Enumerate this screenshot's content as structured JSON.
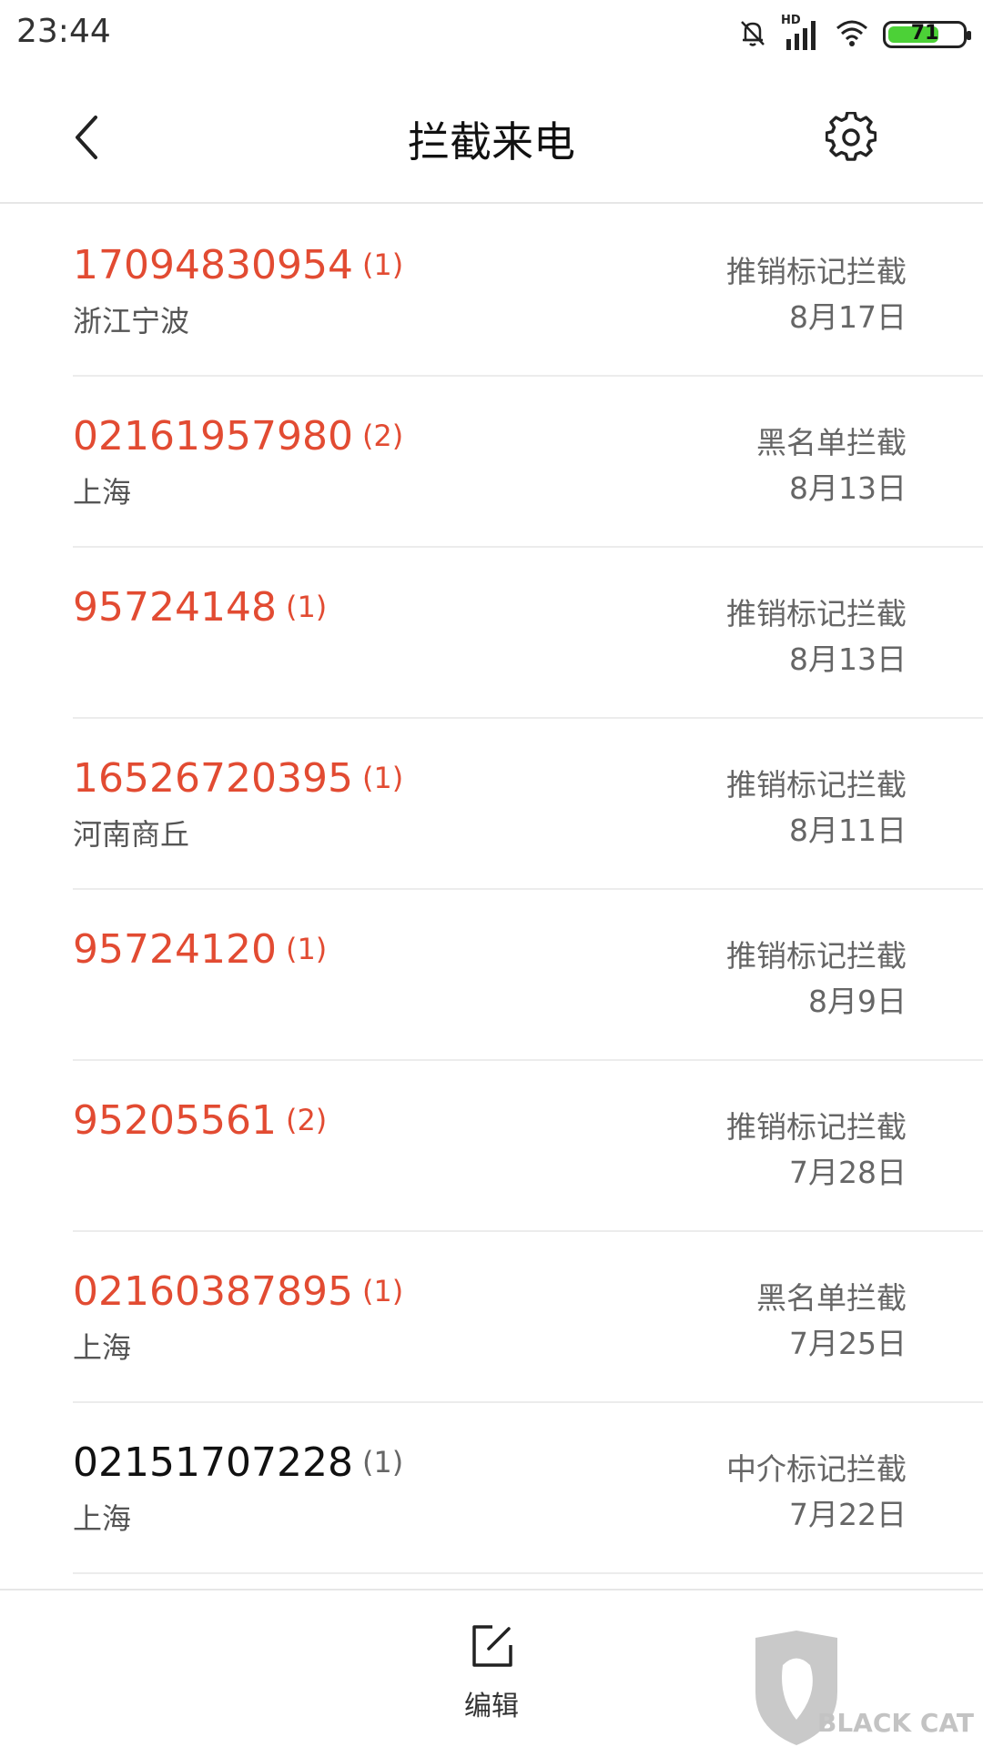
{
  "status_bar": {
    "time": "23:44",
    "hd_label": "HD",
    "battery_level": 71,
    "battery_label": "71",
    "battery_color": "#4cd137"
  },
  "header": {
    "title": "拦截来电",
    "back_icon": "chevron-left-icon",
    "settings_icon": "gear-icon"
  },
  "calls": [
    {
      "number": "17094830954",
      "count": "(1)",
      "location": "浙江宁波",
      "reason": "推销标记拦截",
      "date": "8月17日",
      "highlight": true
    },
    {
      "number": "02161957980",
      "count": "(2)",
      "location": "上海",
      "reason": "黑名单拦截",
      "date": "8月13日",
      "highlight": true
    },
    {
      "number": "95724148",
      "count": "(1)",
      "location": "",
      "reason": "推销标记拦截",
      "date": "8月13日",
      "highlight": true
    },
    {
      "number": "16526720395",
      "count": "(1)",
      "location": "河南商丘",
      "reason": "推销标记拦截",
      "date": "8月11日",
      "highlight": true
    },
    {
      "number": "95724120",
      "count": "(1)",
      "location": "",
      "reason": "推销标记拦截",
      "date": "8月9日",
      "highlight": true
    },
    {
      "number": "95205561",
      "count": "(2)",
      "location": "",
      "reason": "推销标记拦截",
      "date": "7月28日",
      "highlight": true
    },
    {
      "number": "02160387895",
      "count": "(1)",
      "location": "上海",
      "reason": "黑名单拦截",
      "date": "7月25日",
      "highlight": true
    },
    {
      "number": "02151707228",
      "count": "(1)",
      "location": "上海",
      "reason": "中介标记拦截",
      "date": "7月22日",
      "highlight": false
    }
  ],
  "bottom": {
    "edit_label": "编辑",
    "edit_icon": "edit-icon"
  },
  "watermark": {
    "text": "BLACK CAT"
  },
  "colors": {
    "accent_red": "#e24b32"
  }
}
